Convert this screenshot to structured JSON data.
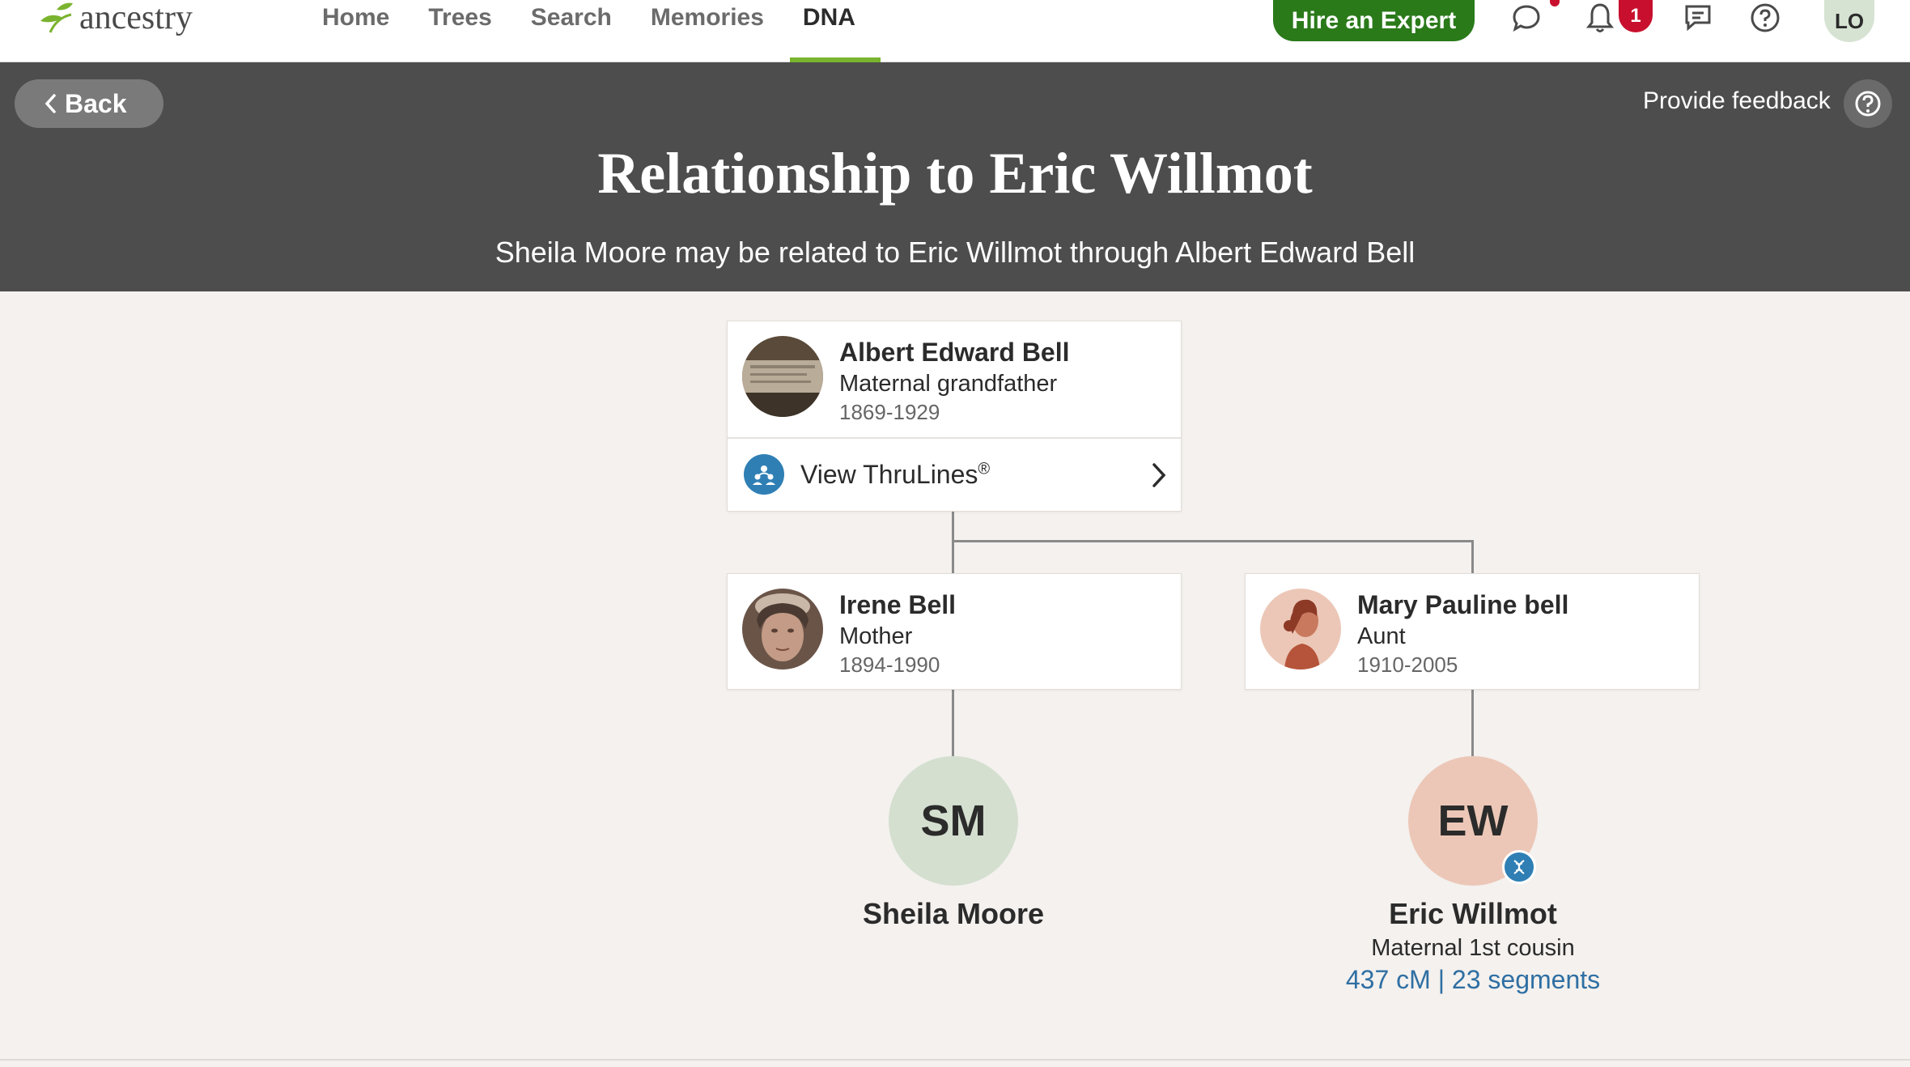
{
  "nav": {
    "logo_text": "ancestry",
    "links": [
      "Home",
      "Trees",
      "Search",
      "Memories",
      "DNA"
    ],
    "active_link": "DNA",
    "hire_expert": "Hire an Expert",
    "notification_count": "1",
    "user_initials": "LO",
    "icons": [
      "messages-icon",
      "bell-icon",
      "chat-icon",
      "help-icon"
    ]
  },
  "header": {
    "back_label": "Back",
    "feedback_label": "Provide feedback",
    "title": "Relationship to Eric Willmot",
    "subtitle": "Sheila Moore may be related to Eric Willmot through Albert Edward Bell"
  },
  "ancestor": {
    "name": "Albert Edward Bell",
    "relationship": "Maternal grandfather",
    "years": "1869-1929",
    "thrulines_label": "View ThruLines",
    "thrulines_mark": "®"
  },
  "left_parent": {
    "name": "Irene Bell",
    "relationship": "Mother",
    "years": "1894-1990"
  },
  "right_parent": {
    "name": "Mary Pauline bell",
    "relationship": "Aunt",
    "years": "1910-2005"
  },
  "self": {
    "initials": "SM",
    "name": "Sheila Moore",
    "color": "#d4dfd0"
  },
  "match": {
    "initials": "EW",
    "name": "Eric Willmot",
    "relationship": "Maternal 1st cousin",
    "dna_info": "437 cM | 23 segments",
    "color": "#ecc7b7"
  },
  "colors": {
    "brand_green": "#2a7a1a",
    "accent_green": "#7ab32e",
    "header_bg": "#4d4d4d",
    "link_blue": "#2f6fa3"
  }
}
